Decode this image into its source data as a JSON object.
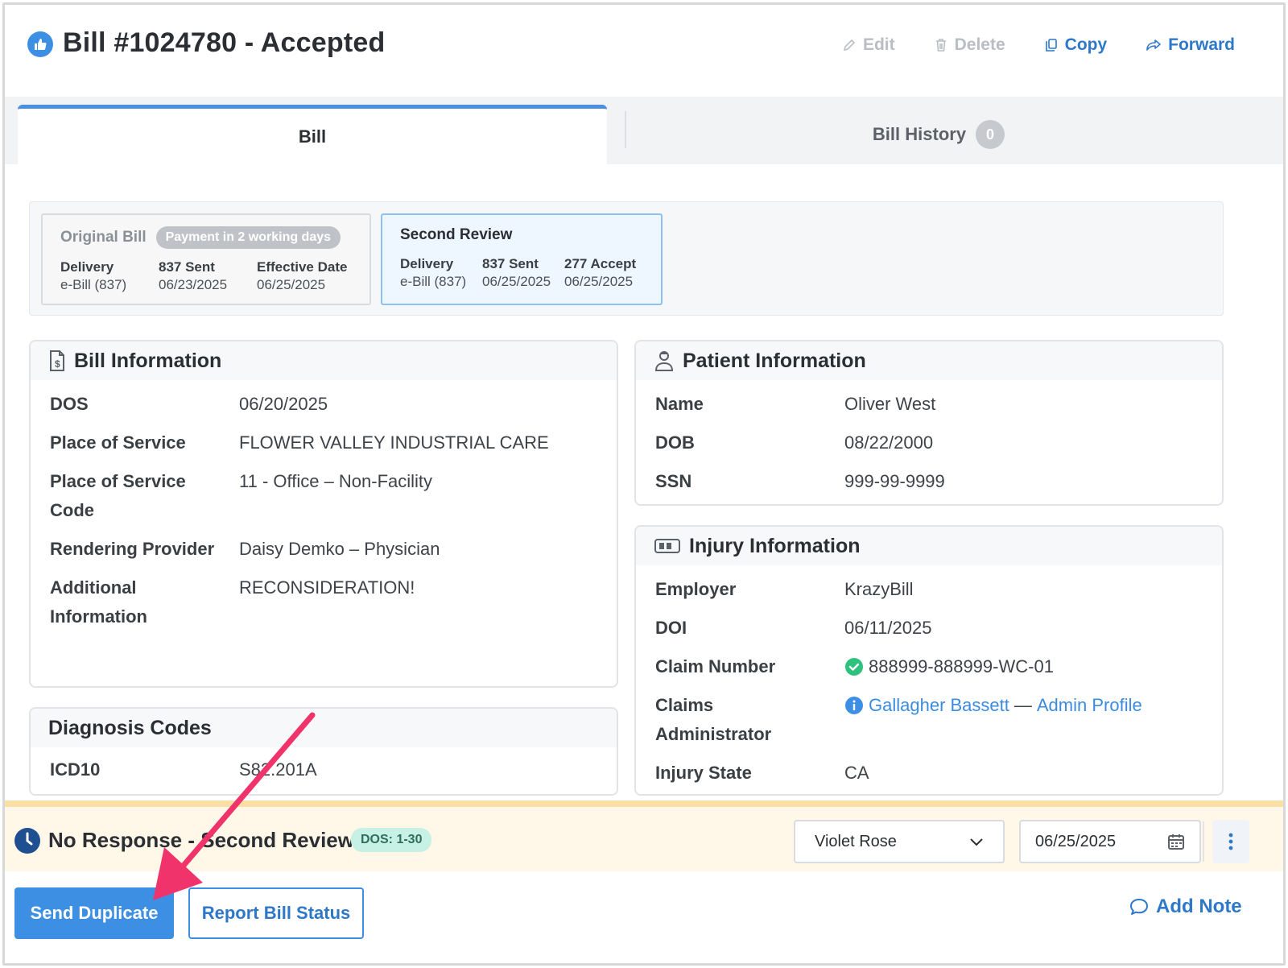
{
  "header": {
    "title": "Bill #1024780 - Accepted",
    "actions": {
      "edit": "Edit",
      "delete": "Delete",
      "copy": "Copy",
      "forward": "Forward"
    }
  },
  "tabs": {
    "bill": "Bill",
    "history": "Bill History",
    "history_count": "0"
  },
  "review_strip": {
    "original": {
      "title": "Original Bill",
      "pill": "Payment in 2 working days",
      "columns": [
        {
          "head": "Delivery",
          "value": "e-Bill (837)"
        },
        {
          "head": "837 Sent",
          "value": "06/23/2025"
        },
        {
          "head": "Effective Date",
          "value": "06/25/2025"
        }
      ]
    },
    "second": {
      "title": "Second Review",
      "columns": [
        {
          "head": "Delivery",
          "value": "e-Bill (837)"
        },
        {
          "head": "837 Sent",
          "value": "06/25/2025"
        },
        {
          "head": "277 Accept",
          "value": "06/25/2025"
        }
      ]
    }
  },
  "bill_info": {
    "title": "Bill Information",
    "rows": [
      {
        "label": "DOS",
        "value": "06/20/2025"
      },
      {
        "label": "Place of Service",
        "value": "FLOWER VALLEY INDUSTRIAL CARE"
      },
      {
        "label": "Place of Service",
        "label2": "Code",
        "value": "11 - Office – Non-Facility"
      },
      {
        "label": "Rendering Provider",
        "value": "Daisy Demko – Physician"
      },
      {
        "label": "Additional",
        "label2": "Information",
        "value": "RECONSIDERATION!"
      }
    ]
  },
  "diagnosis": {
    "title": "Diagnosis Codes",
    "rows": [
      {
        "label": "ICD10",
        "value": "S82.201A"
      }
    ]
  },
  "patient_info": {
    "title": "Patient Information",
    "rows": [
      {
        "label": "Name",
        "value": "Oliver West"
      },
      {
        "label": "DOB",
        "value": "08/22/2000"
      },
      {
        "label": "SSN",
        "value": "999-99-9999"
      }
    ]
  },
  "injury_info": {
    "title": "Injury Information",
    "rows": [
      {
        "label": "Employer",
        "value": "KrazyBill"
      },
      {
        "label": "DOI",
        "value": "06/11/2025"
      },
      {
        "label": "Claim Number",
        "value": "888999-888999-WC-01"
      },
      {
        "label": "Claims",
        "label2": "Administrator",
        "link1": "Gallagher Bassett",
        "sep": "—",
        "link2": "Admin Profile"
      },
      {
        "label": "Injury State",
        "value": "CA"
      }
    ]
  },
  "status": {
    "title": "No Response - Second Review",
    "pill": "DOS: 1-30",
    "assignee": "Violet Rose",
    "date": "06/25/2025"
  },
  "buttons": {
    "send_duplicate": "Send Duplicate",
    "report_status": "Report Bill Status",
    "add_note": "Add Note"
  },
  "colors": {
    "accent": "#3d8fe3",
    "arrow": "#f0346b",
    "status_bg": "#fff7e8",
    "success": "#2ec27e"
  }
}
